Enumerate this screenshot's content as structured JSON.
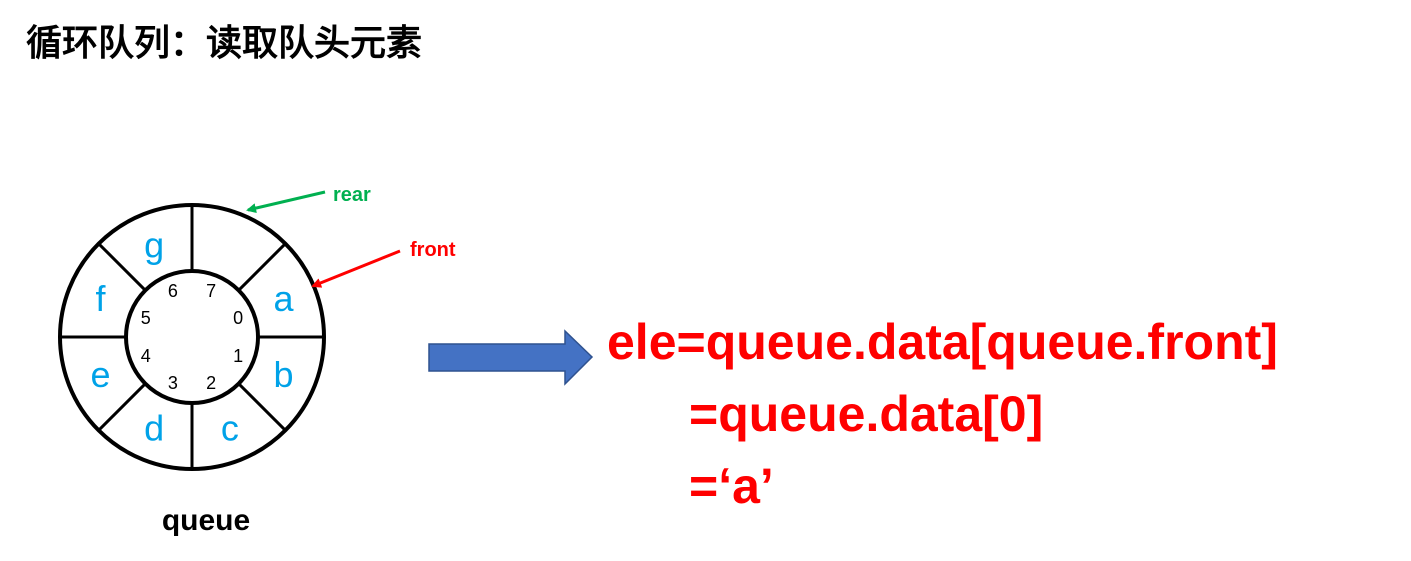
{
  "title": "循环队列：读取队头元素",
  "queue": {
    "label": "queue",
    "capacity": 8,
    "slots": [
      {
        "index": "0",
        "value": "a"
      },
      {
        "index": "1",
        "value": "b"
      },
      {
        "index": "2",
        "value": "c"
      },
      {
        "index": "3",
        "value": "d"
      },
      {
        "index": "4",
        "value": "e"
      },
      {
        "index": "5",
        "value": "f"
      },
      {
        "index": "6",
        "value": "g"
      },
      {
        "index": "7",
        "value": ""
      }
    ]
  },
  "pointers": {
    "rear": {
      "label": "rear",
      "slot": 7,
      "color": "#00b050"
    },
    "front": {
      "label": "front",
      "slot": 0,
      "color": "#ff0000"
    }
  },
  "arrow_color": "#4472c4",
  "value_color": "#00a2e8",
  "code": {
    "color": "#ff0000",
    "lines": [
      "ele=queue.data[queue.front]",
      "=queue.data[0]",
      "=‘a’"
    ]
  }
}
